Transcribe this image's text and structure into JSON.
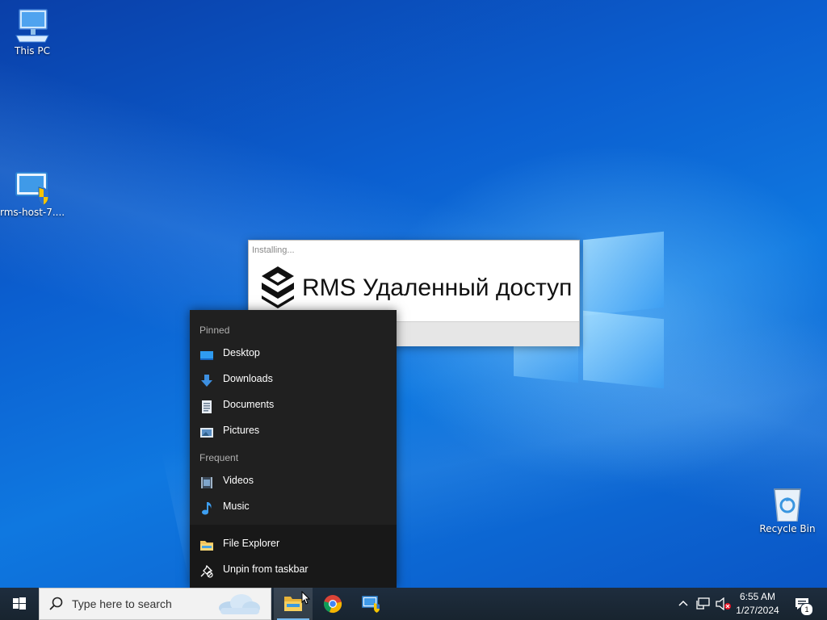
{
  "desktop": {
    "icons": [
      {
        "label": "This PC",
        "icon": "computer-icon"
      },
      {
        "label": "rms-host-7....",
        "icon": "installer-shield-icon"
      },
      {
        "label": "Recycle Bin",
        "icon": "recycle-bin-icon"
      }
    ]
  },
  "installer": {
    "status": "Installing...",
    "brand": "RMS Удаленный доступ"
  },
  "jumplist": {
    "pinned_header": "Pinned",
    "pinned": [
      {
        "label": "Desktop",
        "icon": "desktop-folder-icon"
      },
      {
        "label": "Downloads",
        "icon": "download-arrow-icon"
      },
      {
        "label": "Documents",
        "icon": "document-icon"
      },
      {
        "label": "Pictures",
        "icon": "picture-icon"
      }
    ],
    "frequent_header": "Frequent",
    "frequent": [
      {
        "label": "Videos",
        "icon": "video-icon"
      },
      {
        "label": "Music",
        "icon": "music-note-icon"
      }
    ],
    "actions": [
      {
        "label": "File Explorer",
        "icon": "folder-icon"
      },
      {
        "label": "Unpin from taskbar",
        "icon": "unpin-icon"
      }
    ]
  },
  "taskbar": {
    "search_placeholder": "Type here to search",
    "time": "6:55 AM",
    "date": "1/27/2024",
    "notification_count": "1"
  },
  "colors": {
    "accent": "#0078d7",
    "taskbar": "#1c2a3a",
    "jumplist_bg": "#202020"
  }
}
